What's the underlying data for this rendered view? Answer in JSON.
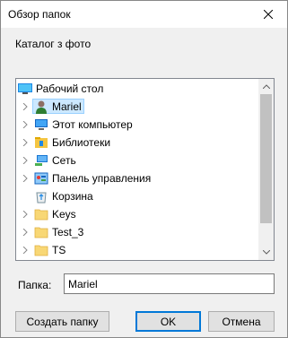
{
  "window": {
    "title": "Обзор папок"
  },
  "description": "Каталог з фото",
  "tree": {
    "items": [
      {
        "label": "Рабочий стол",
        "icon": "desktop-icon",
        "expandable": false,
        "selected": false
      },
      {
        "label": "Mariel",
        "icon": "user-folder-icon",
        "expandable": true,
        "selected": true
      },
      {
        "label": "Этот компьютер",
        "icon": "computer-icon",
        "expandable": true,
        "selected": false
      },
      {
        "label": "Библиотеки",
        "icon": "libraries-icon",
        "expandable": true,
        "selected": false
      },
      {
        "label": "Сеть",
        "icon": "network-icon",
        "expandable": true,
        "selected": false
      },
      {
        "label": "Панель управления",
        "icon": "control-panel-icon",
        "expandable": true,
        "selected": false
      },
      {
        "label": "Корзина",
        "icon": "recycle-bin-icon",
        "expandable": false,
        "selected": false
      },
      {
        "label": "Keys",
        "icon": "folder-icon",
        "expandable": true,
        "selected": false
      },
      {
        "label": "Test_3",
        "icon": "folder-icon",
        "expandable": true,
        "selected": false
      },
      {
        "label": "TS",
        "icon": "folder-icon",
        "expandable": true,
        "selected": false
      }
    ]
  },
  "folder": {
    "label": "Папка:",
    "value": "Mariel"
  },
  "buttons": {
    "new_folder": "Создать папку",
    "ok": "OK",
    "cancel": "Отмена"
  },
  "colors": {
    "selection": "#cce8ff",
    "selection_border": "#99d1ff",
    "accent": "#0078d7"
  }
}
